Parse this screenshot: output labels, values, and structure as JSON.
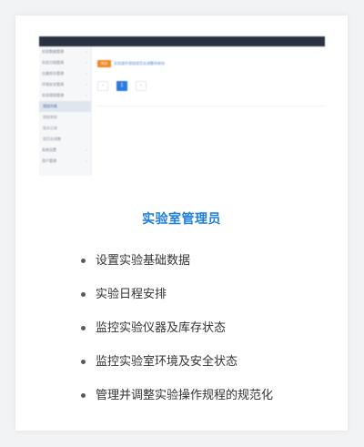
{
  "card": {
    "title": "实验室管理员",
    "bullets": [
      "设置实验基础数据",
      "实验日程安排",
      "监控实验仪器及库存状态",
      "监控实验室环境及安全状态",
      "管理并调整实验操作规程的规范化"
    ]
  },
  "preview": {
    "sidebar": [
      {
        "label": "实验数据管理",
        "arrow": "›"
      },
      {
        "label": "实验日程管理",
        "arrow": "›"
      },
      {
        "label": "仪器库存管理",
        "arrow": "›"
      },
      {
        "label": "环境安全管理",
        "arrow": "›"
      },
      {
        "label": "实验规程管理",
        "arrow": "›"
      },
      {
        "label": "规程列表",
        "arrow": ""
      },
      {
        "label": "规程审核",
        "arrow": ""
      },
      {
        "label": "版本记录",
        "arrow": ""
      },
      {
        "label": "规范化调整",
        "arrow": ""
      },
      {
        "label": "系统设置",
        "arrow": "›"
      },
      {
        "label": "用户管理",
        "arrow": "›"
      }
    ],
    "tag": "待办",
    "link_text": "实验操作规程规范化调整待审核",
    "pagination": [
      "‹",
      "1",
      "›"
    ],
    "colors": {
      "accent": "#1e7fe0",
      "tag": "#f08a24",
      "topbar": "#2b3140"
    }
  }
}
